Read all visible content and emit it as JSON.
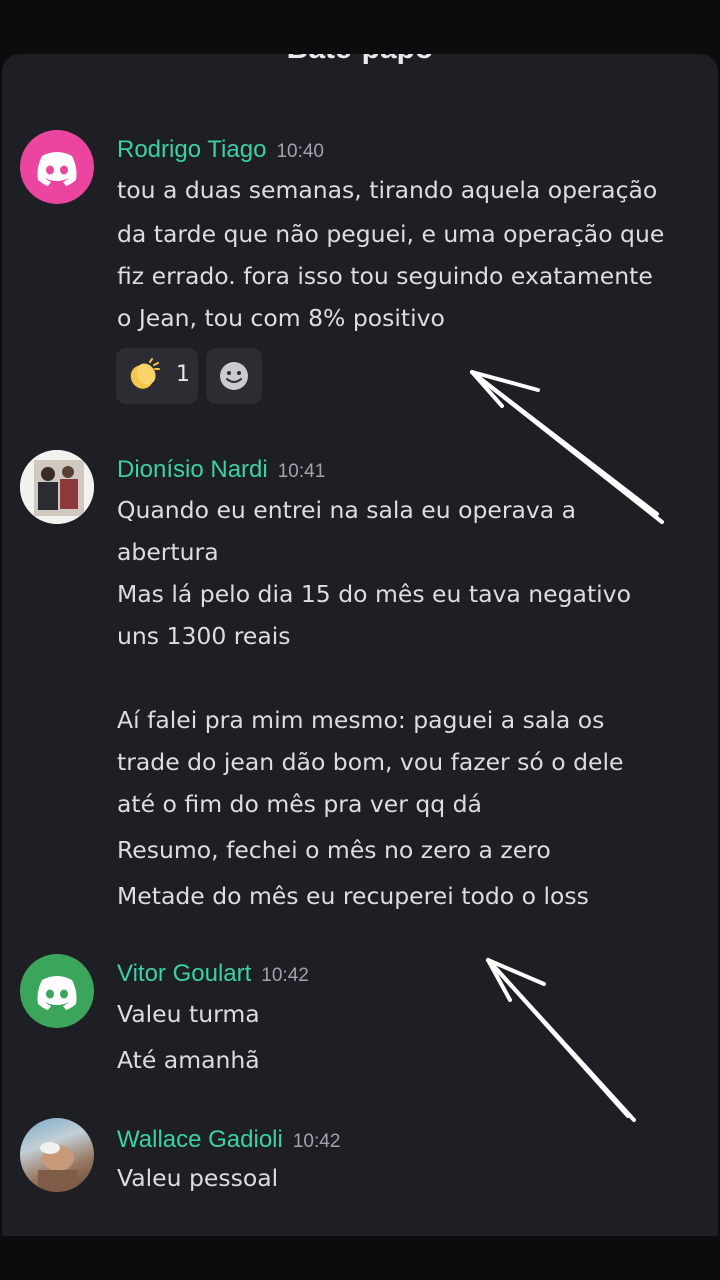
{
  "header": {
    "title": "Bate-papo"
  },
  "messages": [
    {
      "author": "Rodrigo Tiago",
      "time": "10:40",
      "avatar": "discord-icon",
      "lines": [
        "tou a duas semanas, tirando aquela operação",
        "da tarde que não peguei, e uma operação que",
        "fiz errado. fora isso tou seguindo exatamente",
        "o Jean, tou com 8% positivo"
      ],
      "reaction": {
        "emoji": "clapping-hands-icon",
        "count": "1"
      }
    },
    {
      "author": "Dionísio Nardi",
      "time": "10:41",
      "avatar": "photo",
      "lines": [
        "Quando eu entrei na sala eu operava a",
        "abertura",
        "Mas lá pelo dia 15 do mês eu tava negativo",
        "uns 1300 reais",
        "Aí falei pra mim mesmo: paguei a sala os",
        "trade do jean dão bom, vou fazer só o dele",
        "até o fim do mês pra ver qq dá",
        "Resumo, fechei o mês no zero a zero",
        "Metade do mês eu recuperei todo o loss"
      ]
    },
    {
      "author": "Vitor Goulart",
      "time": "10:42",
      "avatar": "discord-icon",
      "lines": [
        "Valeu turma",
        "Até amanhã"
      ]
    },
    {
      "author": "Wallace Gadioli",
      "time": "10:42",
      "avatar": "photo",
      "lines": [
        "Valeu pessoal"
      ]
    }
  ],
  "colors": {
    "background": "#1e1f24",
    "author": "#3bd1a6",
    "discord_pink": "#eb459f",
    "discord_green": "#3ba55c",
    "text": "#dcdde1"
  }
}
